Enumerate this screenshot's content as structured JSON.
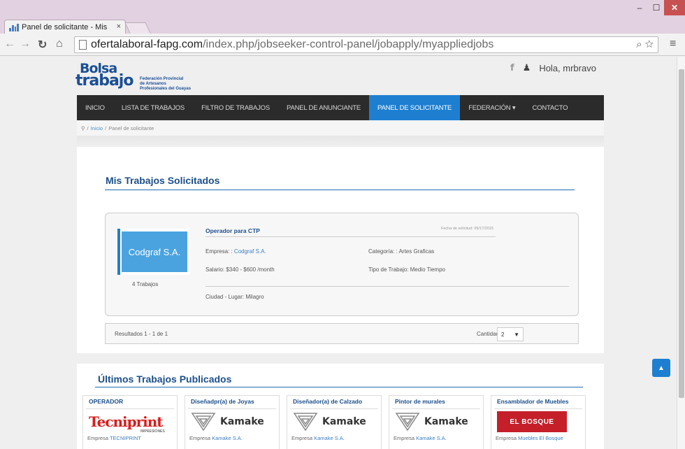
{
  "browser": {
    "tab_title": "Panel de solicitante - Mis",
    "tab_close": "×",
    "url_domain": "ofertalaboral-fapg.com",
    "url_path": "/index.php/jobseeker-control-panel/jobapply/myappliedjobs",
    "window_min": "–",
    "window_max": "☐",
    "window_close": "✕"
  },
  "site": {
    "logo_line1": "Bolsa",
    "logo_line2": "trabajo",
    "logo_fed_line1": "Federación Provincial",
    "logo_fed_line2": "de Artesanos",
    "logo_fed_line3": "Profesionales del Guayas",
    "facebook_icon": "f",
    "greeting": "Hola, mrbravo"
  },
  "nav": {
    "items": [
      {
        "label": "INICIO",
        "active": false
      },
      {
        "label": "LISTA DE TRABAJOS",
        "active": false
      },
      {
        "label": "FILTRO DE TRABAJOS",
        "active": false
      },
      {
        "label": "PANEL DE ANUNCIANTE",
        "active": false
      },
      {
        "label": "PANEL DE SOLICITANTE",
        "active": true
      },
      {
        "label": "FEDERACIÓN ▾",
        "active": false
      },
      {
        "label": "CONTACTO",
        "active": false
      }
    ]
  },
  "breadcrumb": {
    "home_link": "Inicio",
    "separator": "/",
    "current": "Panel de solicitante"
  },
  "applied": {
    "section_title": "Mis Trabajos Solicitados",
    "job": {
      "company_logo_text": "Codgraf S.A.",
      "job_count": "4 Trabajos",
      "title": "Operador para CTP",
      "date": "Fecha de solicitud: 05/17/2015",
      "empresa_label": "Empresa: :",
      "empresa_value": "Codgraf S.A.",
      "categoria": "Categoría: : Artes Graficas",
      "salario": "Salario: $340 - $600 /month",
      "tipo": "Tipo de Trabajo: Medio Tiempo",
      "ciudad": "Ciudad - Lugar: Milagro"
    },
    "results_text": "Resultados 1 - 1 de 1",
    "cantidad_label": "Cantidad -",
    "cantidad_value": "2",
    "cantidad_caret": "▼"
  },
  "latest": {
    "section_title": "Últimos Trabajos Publicados",
    "tiles": [
      {
        "title": "OPERADOR",
        "company_label": "Empresa",
        "company": "TECNIPRINT",
        "logo": "Tecniprint",
        "logo_sub": "IMPRESIONES"
      },
      {
        "title": "Diseñadpr(a) de Joyas",
        "company_label": "Empresa",
        "company": "Kamake S.A.",
        "logo": "Kamake"
      },
      {
        "title": "Diseñador(a) de Calzado",
        "company_label": "Empresa",
        "company": "Kamake S.A.",
        "logo": "Kamake"
      },
      {
        "title": "Pintor de murales",
        "company_label": "Empresa",
        "company": "Kamake S.A.",
        "logo": "Kamake"
      },
      {
        "title": "Ensamblador de Muebles",
        "company_label": "Empresa",
        "company": "Muebles El Bosque",
        "logo": "EL BOSQUE"
      }
    ]
  },
  "scroll_top_icon": "▲",
  "colors": {
    "accent": "#1e7fd1",
    "navbar": "#2b2b2b",
    "heading": "#1c4f8a"
  }
}
